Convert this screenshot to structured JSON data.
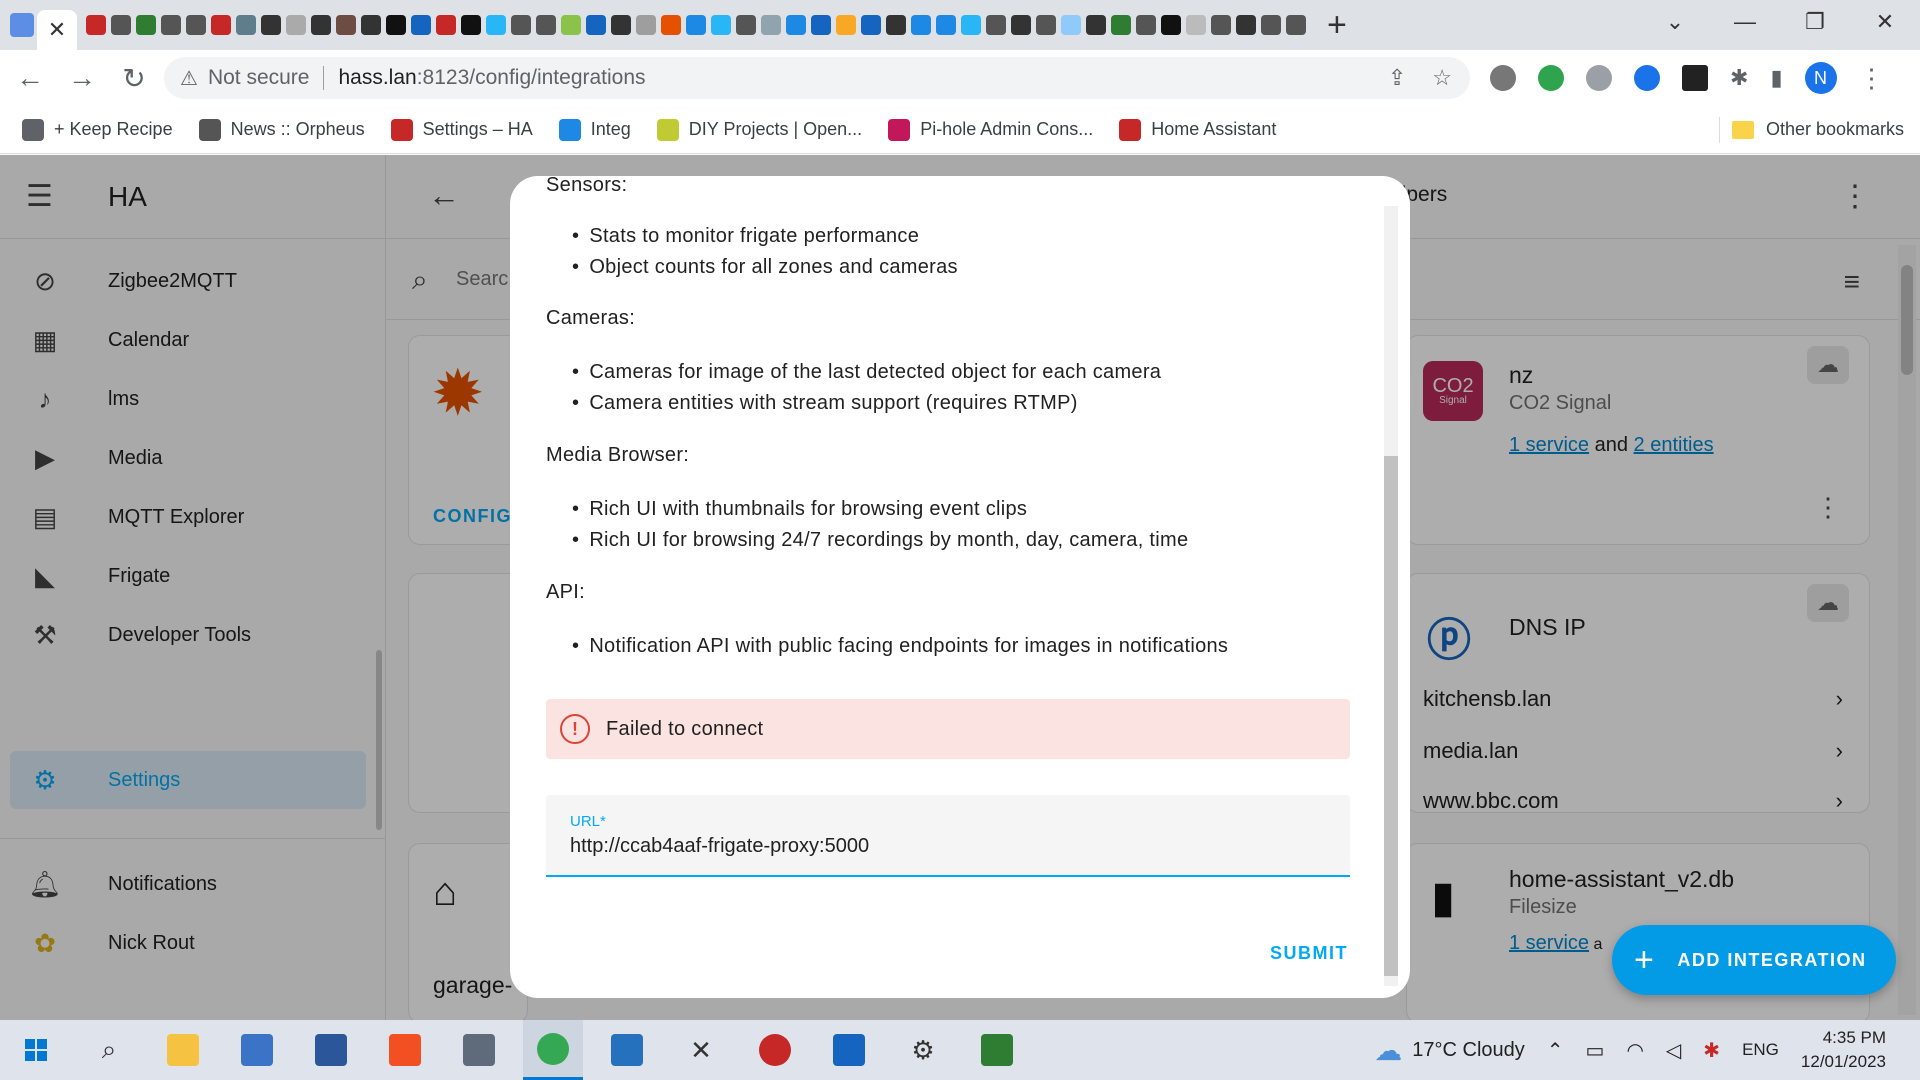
{
  "browser": {
    "address_security": "Not secure",
    "address_host": "hass.lan",
    "address_path": ":8123/config/integrations",
    "profile_initial": "N",
    "bookmarks": [
      {
        "label": "+ Keep Recipe",
        "color": "#5f6368"
      },
      {
        "label": "News :: Orpheus",
        "color": "#555555"
      },
      {
        "label": "Settings – HA",
        "color": "#c62828"
      },
      {
        "label": "Integ",
        "color": "#1e88e5"
      },
      {
        "label": "DIY Projects | Open...",
        "color": "#c0ca33"
      },
      {
        "label": "Pi-hole Admin Cons...",
        "color": "#c2185b"
      },
      {
        "label": "Home Assistant",
        "color": "#c62828"
      }
    ],
    "other_bookmarks": "Other bookmarks"
  },
  "ha": {
    "sidebar_title": "HA",
    "sidebar_items": [
      {
        "label": "Zigbee2MQTT",
        "icon": "zigbee-icon"
      },
      {
        "label": "Calendar",
        "icon": "calendar-icon"
      },
      {
        "label": "lms",
        "icon": "music-icon"
      },
      {
        "label": "Media",
        "icon": "media-icon"
      },
      {
        "label": "MQTT Explorer",
        "icon": "monitor-icon"
      },
      {
        "label": "Frigate",
        "icon": "cctv-icon"
      },
      {
        "label": "Developer Tools",
        "icon": "hammer-icon"
      },
      {
        "label": "Settings",
        "icon": "gear-icon"
      },
      {
        "label": "Notifications",
        "icon": "bell-icon"
      },
      {
        "label": "Nick Rout",
        "icon": "avatar-icon"
      }
    ],
    "header_partial": "elpers",
    "search_placeholder": "Searc",
    "config_partial": "CONFIG",
    "garage_partial": "garage-",
    "cards": {
      "co2": {
        "name": "nz",
        "subtitle": "CO2 Signal",
        "logo_text": "CO2",
        "logo_sub": "Signal",
        "link1": "1 service",
        "and": "and",
        "link2": "2 entities"
      },
      "dns": {
        "name": "DNS IP",
        "entries": [
          "kitchensb.lan",
          "media.lan",
          "www.bbc.com"
        ]
      },
      "db": {
        "name": "home-assistant_v2.db",
        "subtitle": "Filesize",
        "link1": "1 service",
        "partial": "a"
      }
    },
    "fab_label": "ADD INTEGRATION"
  },
  "dialog": {
    "sections": [
      {
        "heading": "Sensors:",
        "items": [
          "Stats to monitor frigate performance",
          "Object counts for all zones and cameras"
        ]
      },
      {
        "heading": "Cameras:",
        "items": [
          "Cameras for image of the last detected object for each camera",
          "Camera entities with stream support (requires RTMP)"
        ]
      },
      {
        "heading": "Media Browser:",
        "items": [
          "Rich UI with thumbnails for browsing event clips",
          "Rich UI for browsing 24/7 recordings by month, day, camera, time"
        ]
      },
      {
        "heading": "API:",
        "items": [
          "Notification API with public facing endpoints for images in notifications"
        ]
      }
    ],
    "error": "Failed to connect",
    "url_label": "URL*",
    "url_value": "http://ccab4aaf-frigate-proxy:5000",
    "submit": "SUBMIT"
  },
  "taskbar": {
    "weather": "17°C Cloudy",
    "language": "ENG",
    "time": "4:35 PM",
    "date": "12/01/2023"
  }
}
